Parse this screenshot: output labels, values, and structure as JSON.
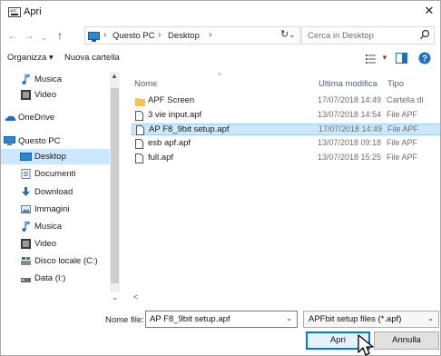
{
  "window": {
    "title": "Apri",
    "app_icon_text": "APF"
  },
  "address": {
    "crumbs": [
      "Questo PC",
      "Desktop"
    ],
    "search_placeholder": "Cerca in Desktop"
  },
  "toolbar": {
    "organize_label": "Organizza ▾",
    "new_folder_label": "Nuova cartella"
  },
  "navigation": {
    "items": [
      {
        "label": "Musica",
        "icon": "music-note-icon",
        "indent": 1
      },
      {
        "label": "Video",
        "icon": "video-icon",
        "indent": 1
      },
      {
        "label": "OneDrive",
        "icon": "cloud-icon",
        "indent": 0
      },
      {
        "label": "Questo PC",
        "icon": "computer-icon",
        "indent": 0
      },
      {
        "label": "Desktop",
        "icon": "desktop-icon",
        "indent": 1,
        "selected": true
      },
      {
        "label": "Documenti",
        "icon": "documents-icon",
        "indent": 1
      },
      {
        "label": "Download",
        "icon": "download-arrow-icon",
        "indent": 1
      },
      {
        "label": "Immagini",
        "icon": "pictures-icon",
        "indent": 1
      },
      {
        "label": "Musica",
        "icon": "music-note-icon",
        "indent": 1
      },
      {
        "label": "Video",
        "icon": "video-icon",
        "indent": 1
      },
      {
        "label": "Disco locale (C:)",
        "icon": "drive-icon",
        "indent": 1
      },
      {
        "label": "Data (I:)",
        "icon": "drive-icon",
        "indent": 1
      }
    ]
  },
  "files": {
    "columns": {
      "name": "Nome",
      "modified": "Ultima modifica",
      "type": "Tipo"
    },
    "rows": [
      {
        "name": "APF Screen",
        "modified": "17/07/2018 14:49",
        "type": "Cartella di",
        "kind": "folder"
      },
      {
        "name": "3 vie input.apf",
        "modified": "13/07/2018 14:54",
        "type": "File APF",
        "kind": "file"
      },
      {
        "name": "AP F8_9bit setup.apf",
        "modified": "17/07/2018 14:49",
        "type": "File APF",
        "kind": "file",
        "selected": true
      },
      {
        "name": "esb apf.apf",
        "modified": "13/07/2018 09:18",
        "type": "File APF",
        "kind": "file"
      },
      {
        "name": "full.apf",
        "modified": "13/07/2018 15:25",
        "type": "File APF",
        "kind": "file"
      }
    ]
  },
  "bottom": {
    "filename_label": "Nome file:",
    "filename_value": "AP F8_9bit setup.apf",
    "filetype_value": "APFbit setup files (*.apf)",
    "open_label": "Apri",
    "cancel_label": "Annulla"
  },
  "colors": {
    "selection": "#cce8ff",
    "accent": "#0078d7",
    "folder": "#f3c54a"
  }
}
